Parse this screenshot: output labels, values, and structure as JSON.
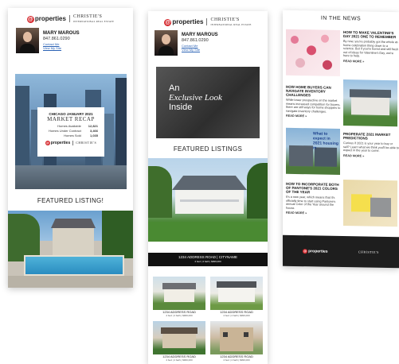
{
  "brand": {
    "properties": "properties",
    "christies": "CHRISTIE'S",
    "christies_sub": "INTERNATIONAL REAL ESTATE"
  },
  "agent": {
    "name": "MARY MAROUS",
    "phone": "847.861.0290",
    "link1": "Contact Me",
    "link2": "View My Site"
  },
  "card1": {
    "recap_kicker": "CHICAGO JANUARY 2021",
    "recap_title": "MARKET RECAP",
    "stats": [
      {
        "label": "Homes Available",
        "value": "12,821"
      },
      {
        "label": "Homes Under Contract",
        "value": "3,466"
      },
      {
        "label": "Homes Sold",
        "value": "1,035"
      }
    ],
    "featured": "FEATURED LISTING!"
  },
  "card2": {
    "excl_line1": "An",
    "excl_line2": "Exclusive Look",
    "excl_line3": "Inside",
    "featured": "FEATURED LISTINGS",
    "address_main": "1234 ADDRESS ROAD | CITYNAME",
    "address_sub": "4 bed | 4 bath | $999,000",
    "grid": [
      {
        "addr": "1234 ADDRESS ROAD",
        "sub": "4 bed | 4 bath | $999,000"
      },
      {
        "addr": "1234 ADDRESS ROAD",
        "sub": "4 bed | 4 bath | $999,000"
      },
      {
        "addr": "1234 ADDRESS ROAD",
        "sub": "4 bed | 4 bath | $999,000"
      },
      {
        "addr": "1234 ADDRESS ROAD",
        "sub": "4 bed | 4 bath | $999,000"
      }
    ]
  },
  "card3": {
    "heading": "IN THE NEWS",
    "articles": [
      {
        "title": "HOW TO MAKE VALENTINE'S DAY 2021 ONE TO REMEMBER",
        "body": "By now, you're probably got the whole at-home celebration thing down to a science. But if you're bored and still fresh out of ideas for Valentine's Day, we're here to help.",
        "more": "READ MORE »"
      },
      {
        "title": "HOW HOME BUYERS CAN NAVIGATE INVENTORY CHALLENGES",
        "body": "While lower prospective on the market means increased competition for buyers, there are still ways for home shoppers to navigate inventory challenges.",
        "more": "READ MORE »"
      },
      {
        "title": "PROPERATE 2021 MARKET PREDICTIONS",
        "body": "Curious if 2021 is your year to buy or sell? Learn what we think you'll be able to expect in the year to come.",
        "more": "READ MORE »",
        "overlay": "What to expect in 2021 housing m"
      },
      {
        "title": "HOW TO INCORPORATE BOTH OF PANTONE'S 2021 COLORS OF THE YEAR",
        "body": "It's a new year, which means that it's officially time to start using Pantone's annual Color of the Year around the house.",
        "more": "READ MORE »"
      }
    ]
  }
}
